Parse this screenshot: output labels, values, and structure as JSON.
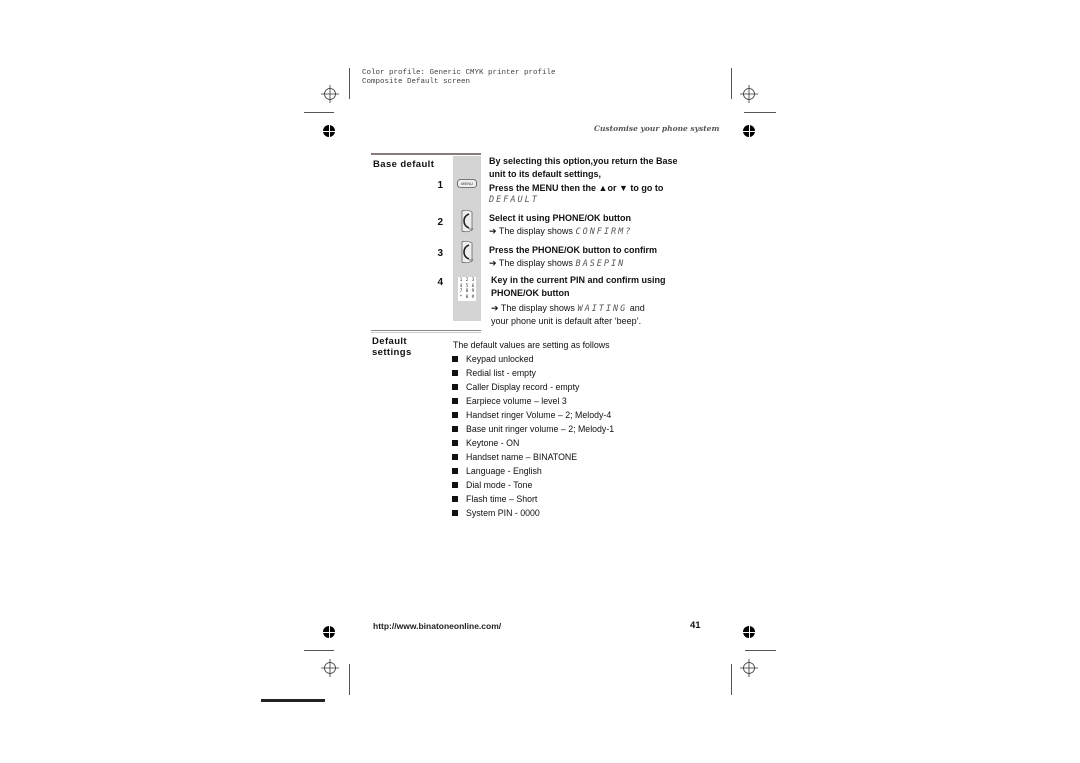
{
  "print_info": {
    "line1": "Color profile: Generic CMYK printer profile",
    "line2": "Composite  Default screen"
  },
  "header": {
    "running_title": "Customise your phone system"
  },
  "base_default": {
    "title": "Base default",
    "intro_line1": "By selecting this option,you return the Base",
    "intro_line2": "unit to its default settings,",
    "steps": [
      {
        "number": "1",
        "icon": "menu-key-icon",
        "text_prefix": "Press the MENU then the",
        "up_arrow": "▲",
        "or": "or",
        "down_arrow": "▼",
        "text_suffix": "to go to",
        "display": "DEFAULT"
      },
      {
        "number": "2",
        "icon": "phone-ok-key-icon",
        "text": "Select it using PHONE/OK button",
        "result_arrow": "➔",
        "result_text": "The display shows",
        "display": "CONFIRM?"
      },
      {
        "number": "3",
        "icon": "phone-ok-key-icon",
        "text": "Press the PHONE/OK button to confirm",
        "result_arrow": "➔",
        "result_text": "The display shows",
        "display": "BASEPIN"
      },
      {
        "number": "4",
        "icon": "keypad-icon",
        "text_line1": "Key in the current PIN and confirm using",
        "text_line2": "PHONE/OK button",
        "result_arrow": "➔",
        "result_text": "The display shows",
        "display": "WAITING",
        "result_suffix": "and",
        "result_line2": "your phone unit is default after ‘beep’."
      }
    ],
    "menu_key_label": "MENU",
    "keypad_keys": [
      "1",
      "2",
      "3",
      "4",
      "5",
      "6",
      "7",
      "8",
      "9",
      "*",
      "0",
      "#"
    ]
  },
  "default_settings": {
    "title_line1": "Default",
    "title_line2": "settings",
    "intro": "The default values are setting as follows",
    "items": [
      "Keypad unlocked",
      "Redial list - empty",
      "Caller Display record - empty",
      "Earpiece volume – level 3",
      "Handset ringer Volume – 2; Melody-4",
      "Base unit ringer volume – 2; Melody-1",
      "Keytone - ON",
      "Handset name – BINATONE",
      "Language - English",
      "Dial mode - Tone",
      "Flash time – Short",
      "System PIN - 0000"
    ]
  },
  "footer": {
    "url": "http://www.binatoneonline.com/",
    "page_number": "41"
  }
}
